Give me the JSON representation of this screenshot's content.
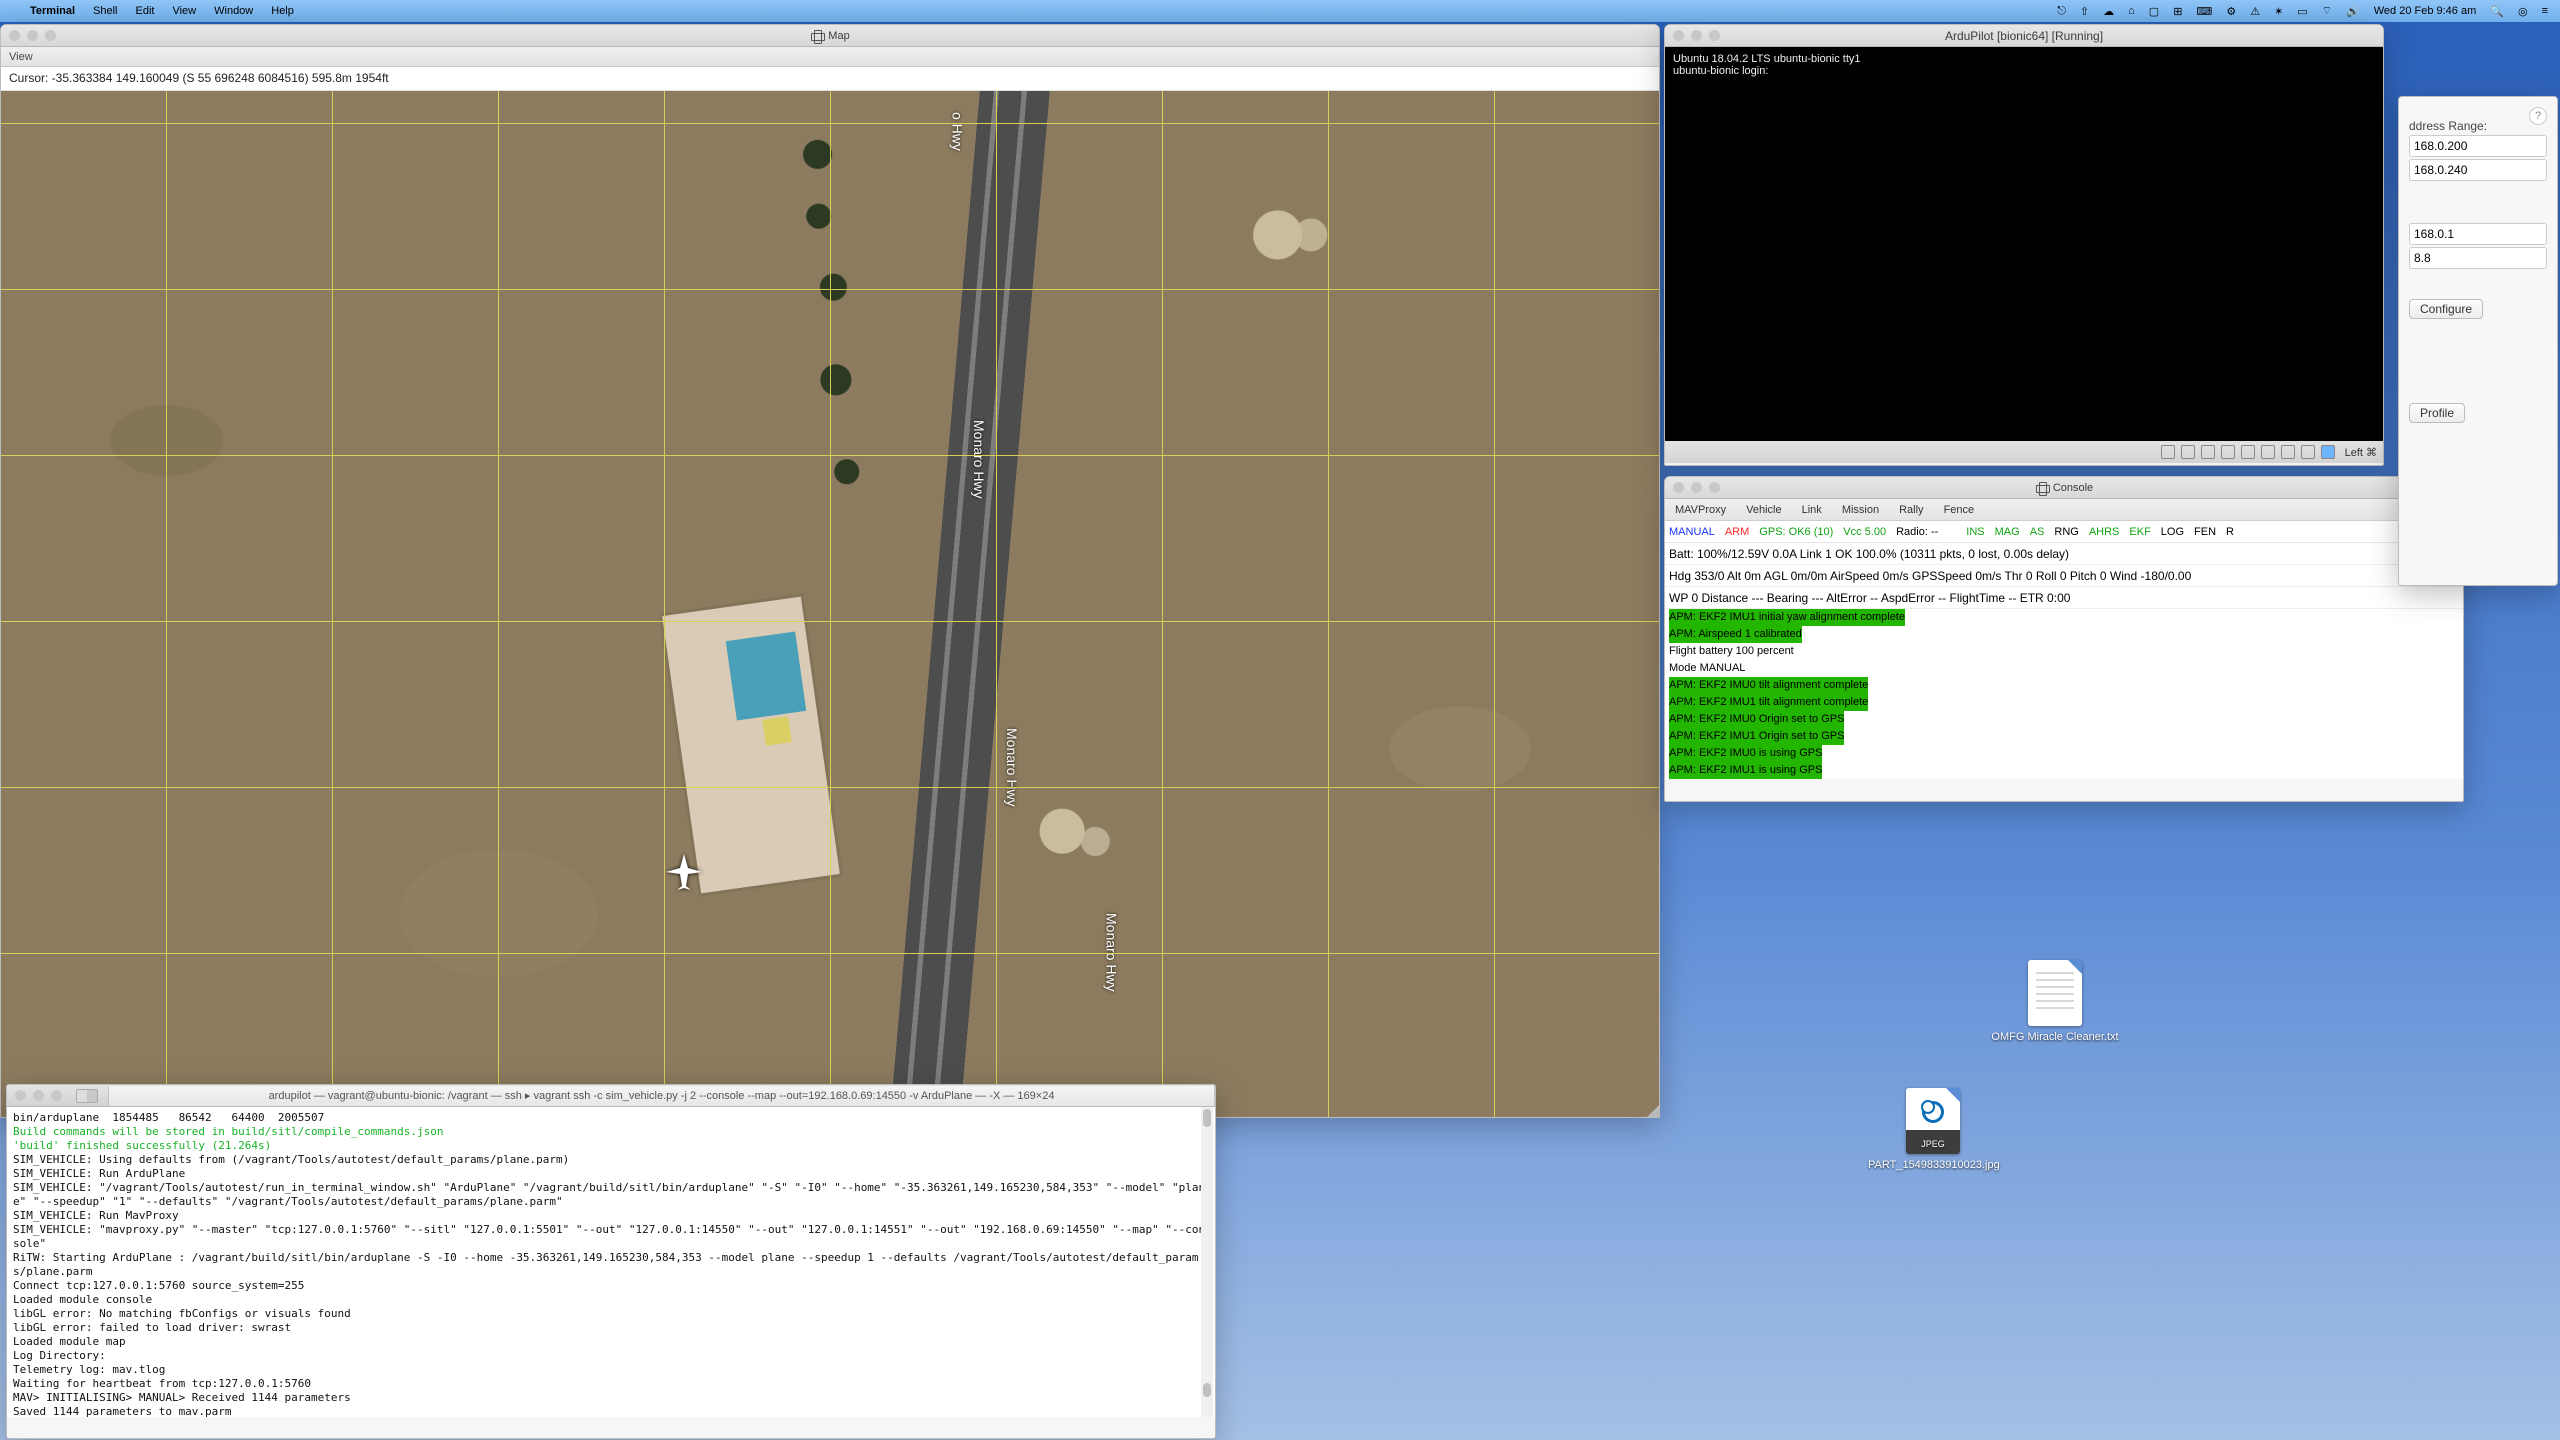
{
  "menubar": {
    "app": "Terminal",
    "items": [
      "Shell",
      "Edit",
      "View",
      "Window",
      "Help"
    ],
    "clock": "Wed 20 Feb  9:46 am"
  },
  "mapwin": {
    "title": "Map",
    "view_label": "View",
    "cursor": "Cursor: -35.363384 149.160049 (S 55 696248 6084516) 595.8m 1954ft",
    "road_labels": [
      "o Hwy",
      "Monaro Hwy",
      "Monaro Hwy",
      "Monaro Hwy"
    ]
  },
  "vmwin": {
    "title": "ArduPilot [bionic64] [Running]",
    "lines": [
      "Ubuntu 18.04.2 LTS ubuntu-bionic tty1",
      "",
      "ubuntu-bionic login:"
    ],
    "status_suffix": "Left ⌘"
  },
  "console": {
    "title": "Console",
    "menu": [
      "MAVProxy",
      "Vehicle",
      "Link",
      "Mission",
      "Rally",
      "Fence"
    ],
    "status": {
      "mode": "MANUAL",
      "arm": "ARM",
      "gps": "GPS: OK6 (10)",
      "vcc": "Vcc 5.00",
      "radio": "Radio: --",
      "ins": "INS",
      "mag": "MAG",
      "as": "AS",
      "rng": "RNG",
      "ahrs": "AHRS",
      "ekf": "EKF",
      "log": "LOG",
      "fen": "FEN",
      "rc": "R"
    },
    "row1": "Batt: 100%/12.59V 0.0A    Link 1 OK 100.0% (10311 pkts, 0 lost, 0.00s delay)",
    "row2": "Hdg 353/0    Alt 0m    AGL 0m/0m    AirSpeed 0m/s    GPSSpeed 0m/s    Thr 0    Roll 0    Pitch 0    Wind -180/0.00",
    "row3": "WP 0    Distance ---    Bearing ---    AltError --    AspdError --    FlightTime --    ETR 0:00",
    "messages": [
      {
        "t": "APM: EKF2 IMU1 initial yaw alignment complete",
        "hl": true
      },
      {
        "t": "APM: Airspeed 1 calibrated",
        "hl": true
      },
      {
        "t": "Flight battery 100 percent",
        "hl": false
      },
      {
        "t": "Mode MANUAL",
        "hl": false
      },
      {
        "t": "APM: EKF2 IMU0 tilt alignment complete",
        "hl": true
      },
      {
        "t": "APM: EKF2 IMU1 tilt alignment complete",
        "hl": true
      },
      {
        "t": "APM: EKF2 IMU0 Origin set to GPS",
        "hl": true
      },
      {
        "t": "APM: EKF2 IMU1 Origin set to GPS",
        "hl": true
      },
      {
        "t": "APM: EKF2 IMU0 is using GPS",
        "hl": true
      },
      {
        "t": "APM: EKF2 IMU1 is using GPS",
        "hl": true
      }
    ]
  },
  "terminal": {
    "tab": "ardupilot — vagrant@ubuntu-bionic: /vagrant — ssh ▸ vagrant ssh -c sim_vehicle.py -j 2 --console --map --out=192.168.0.69:14550 -v ArduPlane — -X — 169×24",
    "path_line": "bin/arduplane  1854485   86542   64400  2005507",
    "green_line1": "Build commands will be stored in build/sitl/compile_commands.json",
    "green_line2": "'build' finished successfully (21.264s)",
    "body": "SIM_VEHICLE: Using defaults from (/vagrant/Tools/autotest/default_params/plane.parm)\nSIM_VEHICLE: Run ArduPlane\nSIM_VEHICLE: \"/vagrant/Tools/autotest/run_in_terminal_window.sh\" \"ArduPlane\" \"/vagrant/build/sitl/bin/arduplane\" \"-S\" \"-I0\" \"--home\" \"-35.363261,149.165230,584,353\" \"--model\" \"plane\" \"--speedup\" \"1\" \"--defaults\" \"/vagrant/Tools/autotest/default_params/plane.parm\"\nSIM_VEHICLE: Run MavProxy\nSIM_VEHICLE: \"mavproxy.py\" \"--master\" \"tcp:127.0.0.1:5760\" \"--sitl\" \"127.0.0.1:5501\" \"--out\" \"127.0.0.1:14550\" \"--out\" \"127.0.0.1:14551\" \"--out\" \"192.168.0.69:14550\" \"--map\" \"--console\"\nRiTW: Starting ArduPlane : /vagrant/build/sitl/bin/arduplane -S -I0 --home -35.363261,149.165230,584,353 --model plane --speedup 1 --defaults /vagrant/Tools/autotest/default_params/plane.parm\nConnect tcp:127.0.0.1:5760 source_system=255\nLoaded module console\nlibGL error: No matching fbConfigs or visuals found\nlibGL error: failed to load driver: swrast\nLoaded module map\nLog Directory: \nTelemetry log: mav.tlog\nWaiting for heartbeat from tcp:127.0.0.1:5760\nMAV> INITIALISING> MANUAL> Received 1144 parameters\nSaved 1144 parameters to mav.parm\n▯"
  },
  "rightwin": {
    "label_range": "ddress Range:",
    "range_lo": "168.0.200",
    "range_hi": "168.0.240",
    "server": "168.0.1",
    "subnet": "8.8",
    "btn_configure": "Configure",
    "btn_profile": "Profile"
  },
  "desktop": {
    "file1": "OMFG Miracle Cleaner.txt",
    "file2": "PART_1549833910023.jpg"
  }
}
